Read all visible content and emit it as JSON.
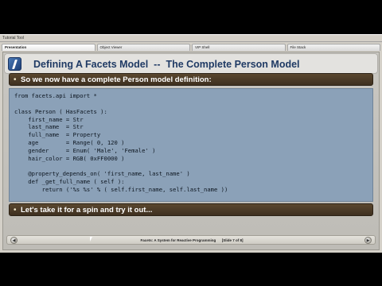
{
  "window": {
    "title": "Tutorial Tool"
  },
  "tabs": [
    "Presentation",
    "Object Viewer",
    "VIP Shell",
    "File Stack"
  ],
  "slide": {
    "title": "Defining A Facets Model  --  The Complete Person Model",
    "bullet1": "So we now have a complete Person model definition:",
    "code": "from facets.api import *\n\nclass Person ( HasFacets ):\n    first_name = Str\n    last_name  = Str\n    full_name  = Property\n    age        = Range( 0, 120 )\n    gender     = Enum( 'Male', 'Female' )\n    hair_color = RGB( 0xFF0000 )\n\n    @property_depends_on( 'first_name, last_name' )\n    def _get_full_name ( self ):\n        return ('%s %s' % ( self.first_name, self.last_name ))",
    "bullet2": "Let's take it for a spin and try it out...",
    "bullet_glyph": "•"
  },
  "status": {
    "text": "Facets: A System for Reactive Programming      [Slide 7 of 8]",
    "nav_left_icon": "◀",
    "nav_right_icon": "▶"
  }
}
